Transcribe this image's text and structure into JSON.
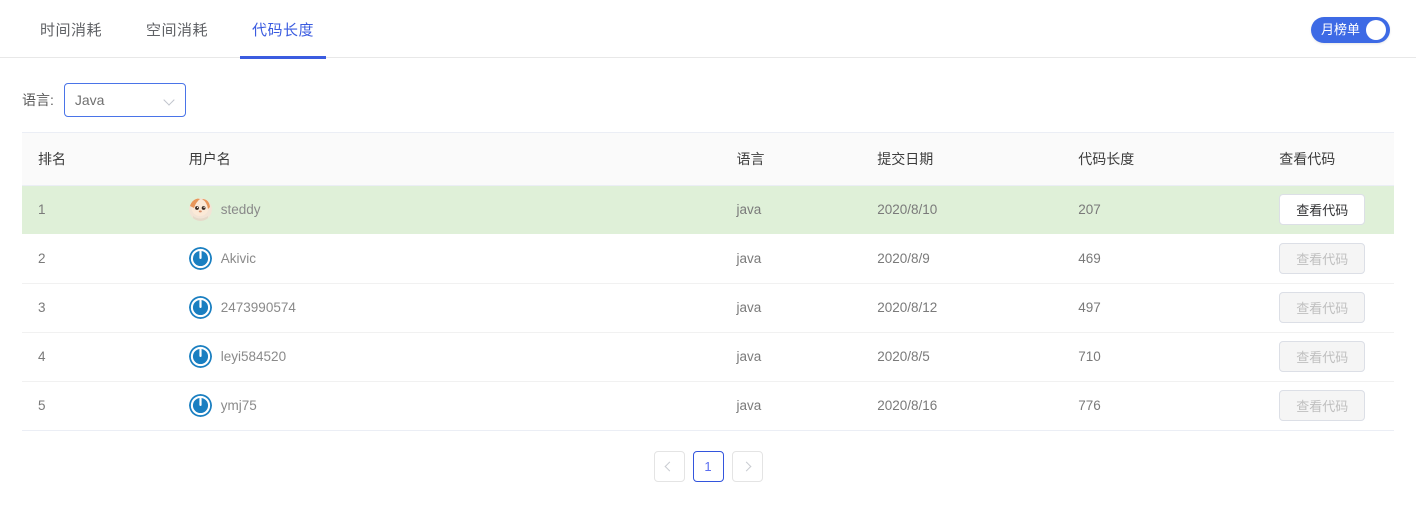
{
  "tabs": [
    {
      "label": "时间消耗",
      "active": false
    },
    {
      "label": "空间消耗",
      "active": false
    },
    {
      "label": "代码长度",
      "active": true
    }
  ],
  "toggle": {
    "label": "月榜单",
    "on": true,
    "color": "#3d6ae5"
  },
  "filter": {
    "label": "语言:",
    "selected": "Java",
    "icon": "chevron-down-icon",
    "focus_color": "#4a74e8"
  },
  "table": {
    "headers": [
      "排名",
      "用户名",
      "语言",
      "提交日期",
      "代码长度",
      "查看代码"
    ],
    "highlight_color": "#dff0d8",
    "rows": [
      {
        "rank": "1",
        "user": "steddy",
        "avatar": "photo-avatar-icon",
        "lang": "java",
        "date": "2020/8/10",
        "length": "207",
        "button": "查看代码",
        "button_enabled": true,
        "highlight": true
      },
      {
        "rank": "2",
        "user": "Akivic",
        "avatar": "power-avatar-icon",
        "lang": "java",
        "date": "2020/8/9",
        "length": "469",
        "button": "查看代码",
        "button_enabled": false,
        "highlight": false
      },
      {
        "rank": "3",
        "user": "2473990574",
        "avatar": "power-avatar-icon",
        "lang": "java",
        "date": "2020/8/12",
        "length": "497",
        "button": "查看代码",
        "button_enabled": false,
        "highlight": false
      },
      {
        "rank": "4",
        "user": "leyi584520",
        "avatar": "power-avatar-icon",
        "lang": "java",
        "date": "2020/8/5",
        "length": "710",
        "button": "查看代码",
        "button_enabled": false,
        "highlight": false
      },
      {
        "rank": "5",
        "user": "ymj75",
        "avatar": "power-avatar-icon",
        "lang": "java",
        "date": "2020/8/16",
        "length": "776",
        "button": "查看代码",
        "button_enabled": false,
        "highlight": false
      }
    ]
  },
  "pagination": {
    "prev_icon": "chevron-left-icon",
    "next_icon": "chevron-right-icon",
    "pages": [
      "1"
    ],
    "current": "1",
    "active_color": "#3355dd"
  }
}
